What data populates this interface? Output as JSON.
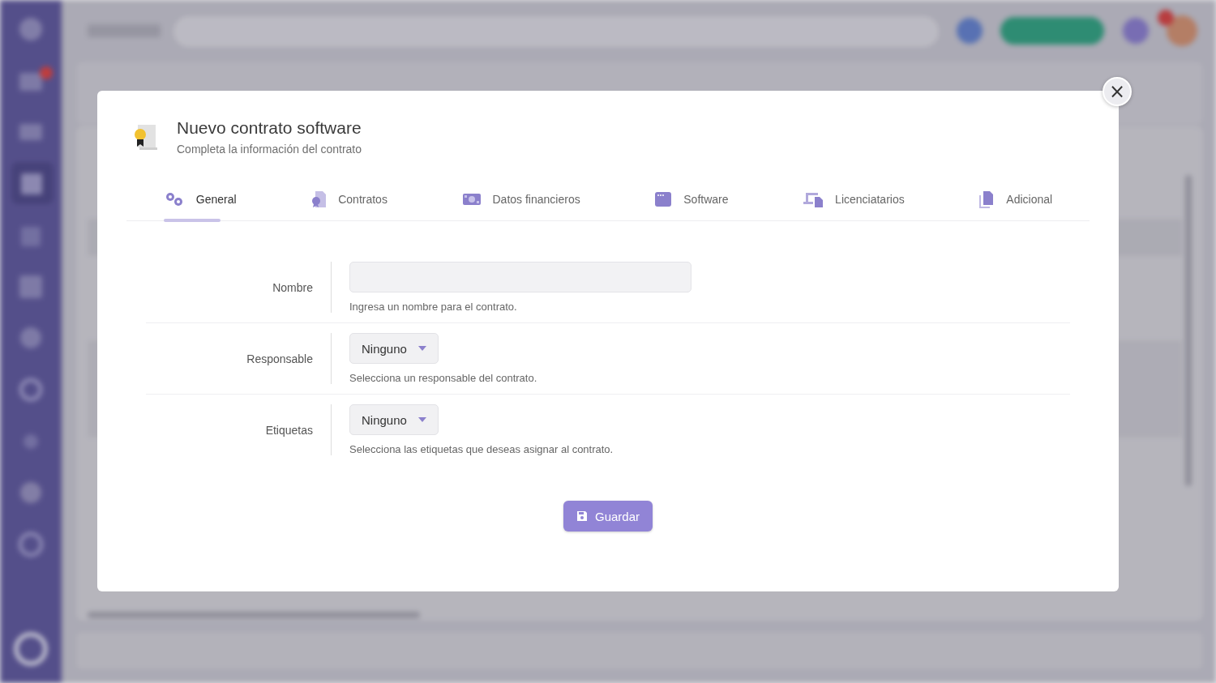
{
  "dialog": {
    "title": "Nuevo contrato software",
    "subtitle": "Completa la información del contrato",
    "close": "×"
  },
  "tabs": [
    {
      "label": "General",
      "selected": true
    },
    {
      "label": "Contratos",
      "selected": false
    },
    {
      "label": "Datos financieros",
      "selected": false
    },
    {
      "label": "Software",
      "selected": false
    },
    {
      "label": "Licenciatarios",
      "selected": false
    },
    {
      "label": "Adicional",
      "selected": false
    }
  ],
  "fields": [
    {
      "kind": "text",
      "label": "Nombre",
      "help": "Ingresa un nombre para el contrato."
    },
    {
      "kind": "select",
      "label": "Responsable",
      "value": "Ninguno",
      "help": "Selecciona un responsable del contrato."
    },
    {
      "kind": "select",
      "label": "Etiquetas",
      "value": "Ninguno",
      "help": "Selecciona las etiquetas que deseas asignar al contrato."
    }
  ],
  "save_button": {
    "label": "Guardar"
  }
}
